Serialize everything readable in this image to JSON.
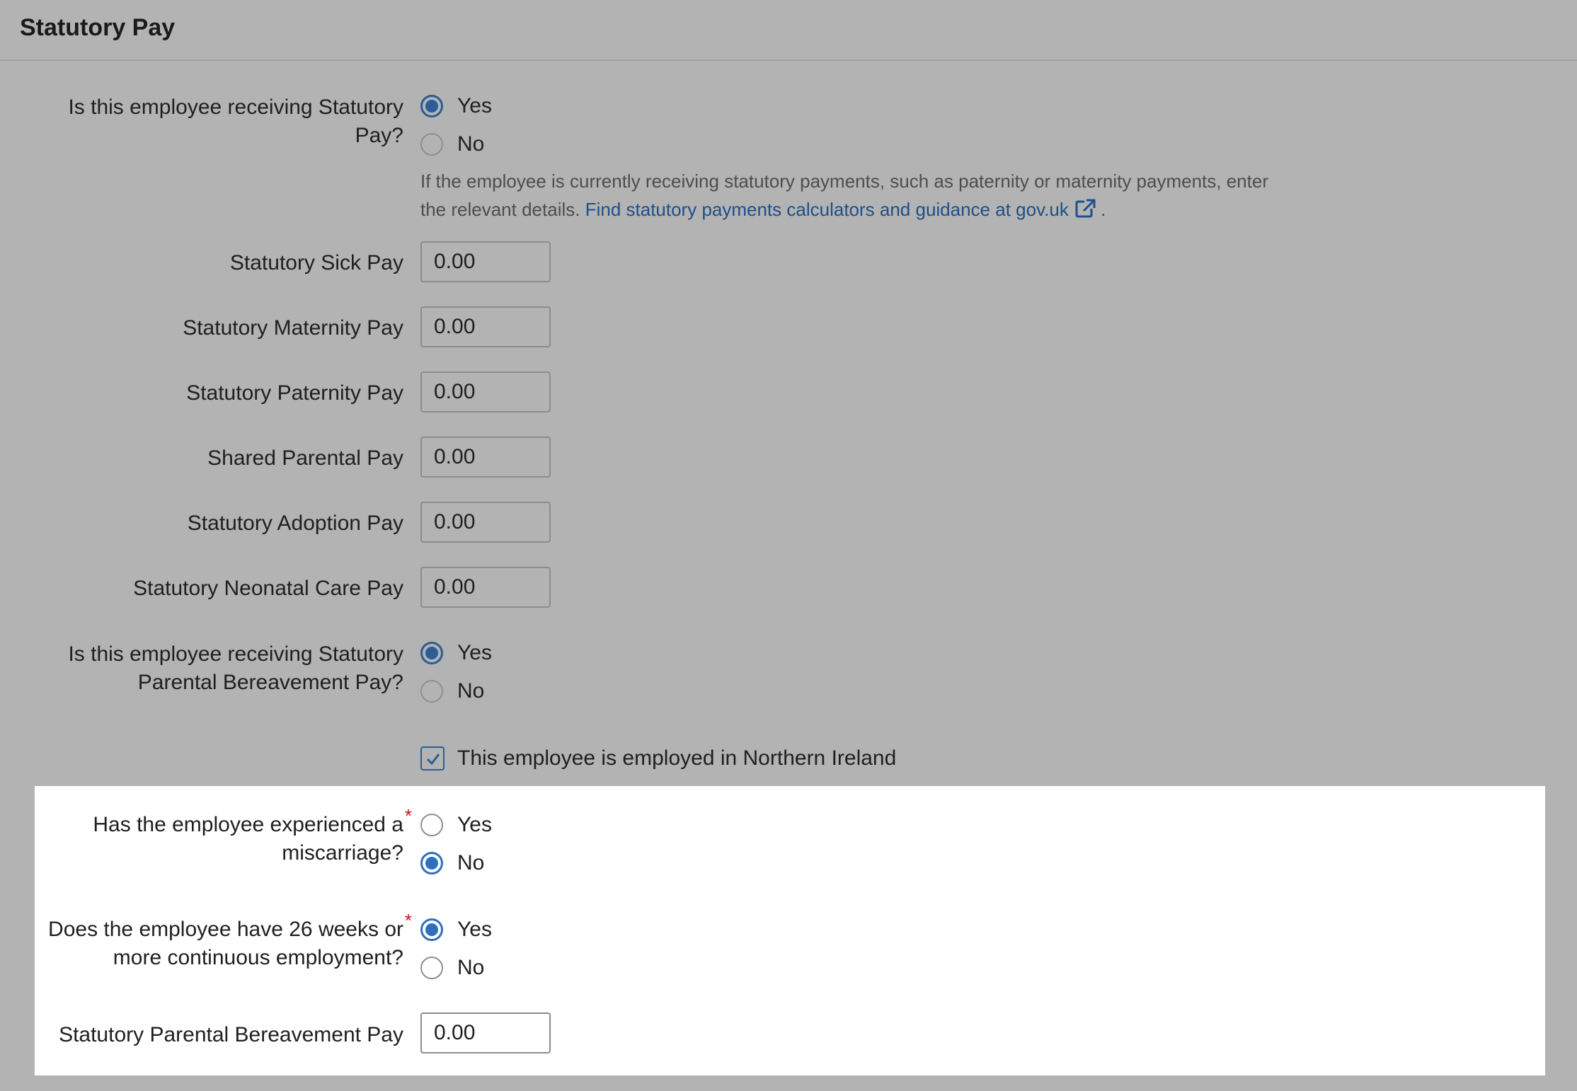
{
  "header": {
    "title": "Statutory Pay"
  },
  "receiving_statutory": {
    "label_line1": "Is this employee receiving Statutory",
    "label_line2": "Pay?",
    "options": [
      "Yes",
      "No"
    ],
    "selected": "Yes"
  },
  "help": {
    "text_line1": "If the employee is currently receiving statutory payments, such as paternity or maternity payments, enter",
    "text_line2": "the relevant details.",
    "link_text": "Find statutory payments calculators and guidance at gov.uk",
    "suffix": "."
  },
  "pay_fields": [
    {
      "label": "Statutory Sick Pay",
      "value": "0.00"
    },
    {
      "label": "Statutory Maternity Pay",
      "value": "0.00"
    },
    {
      "label": "Statutory Paternity Pay",
      "value": "0.00"
    },
    {
      "label": "Shared Parental Pay",
      "value": "0.00"
    },
    {
      "label": "Statutory Adoption Pay",
      "value": "0.00"
    },
    {
      "label": "Statutory Neonatal Care Pay",
      "value": "0.00"
    }
  ],
  "bereavement": {
    "label_line1": "Is this employee receiving Statutory",
    "label_line2": "Parental Bereavement Pay?",
    "options": [
      "Yes",
      "No"
    ],
    "selected": "Yes"
  },
  "northern_ireland": {
    "label": "This employee is employed in Northern Ireland",
    "checked": true
  },
  "miscarriage": {
    "label_line1": "Has the employee experienced a",
    "label_line2": "miscarriage?",
    "required_mark": "*",
    "options": [
      "Yes",
      "No"
    ],
    "selected": "No"
  },
  "continuous_employment": {
    "label_line1": "Does the employee have 26 weeks or",
    "label_line2": "more continuous employment?",
    "required_mark": "*",
    "options": [
      "Yes",
      "No"
    ],
    "selected": "Yes"
  },
  "spbp": {
    "label": "Statutory Parental Bereavement Pay",
    "value": "0.00"
  },
  "colors": {
    "accent": "#2b5d96",
    "link": "#1d4f8a",
    "required": "#c8102e",
    "overlay": "#b3b3b3"
  }
}
